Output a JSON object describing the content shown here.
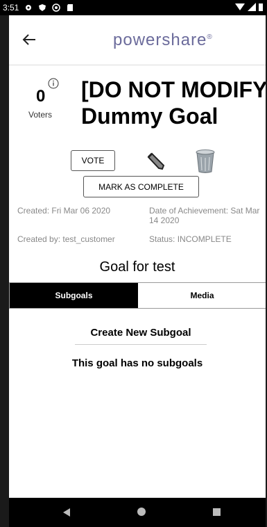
{
  "status_bar": {
    "time": "3:51",
    "left_icons": [
      "settings-icon",
      "shield-icon",
      "at-icon",
      "sd-card-icon"
    ],
    "right_icons": [
      "wifi-icon",
      "signal-icon",
      "battery-icon"
    ]
  },
  "app_bar": {
    "logo_text": "powershare",
    "logo_mark": "®"
  },
  "goal": {
    "voters_count": "0",
    "voters_label": "Voters",
    "title": "[DO NOT MODIFY]\nDummy Goal",
    "vote_label": "VOTE",
    "mark_complete_label": "MARK AS COMPLETE",
    "created": "Created: Fri Mar 06 2020",
    "achievement_date": "Date of Achievement: Sat Mar 14 2020",
    "created_by": "Created by: test_customer",
    "status": "Status: INCOMPLETE",
    "description": "Goal for test"
  },
  "tabs": [
    {
      "label": "Subgoals",
      "active": true
    },
    {
      "label": "Media",
      "active": false
    }
  ],
  "subgoals": {
    "create_label": "Create New Subgoal",
    "empty_message": "This goal has no subgoals"
  },
  "colors": {
    "logo": "#6b6b9b",
    "tab_active_bg": "#000000",
    "meta_text": "#888888"
  }
}
